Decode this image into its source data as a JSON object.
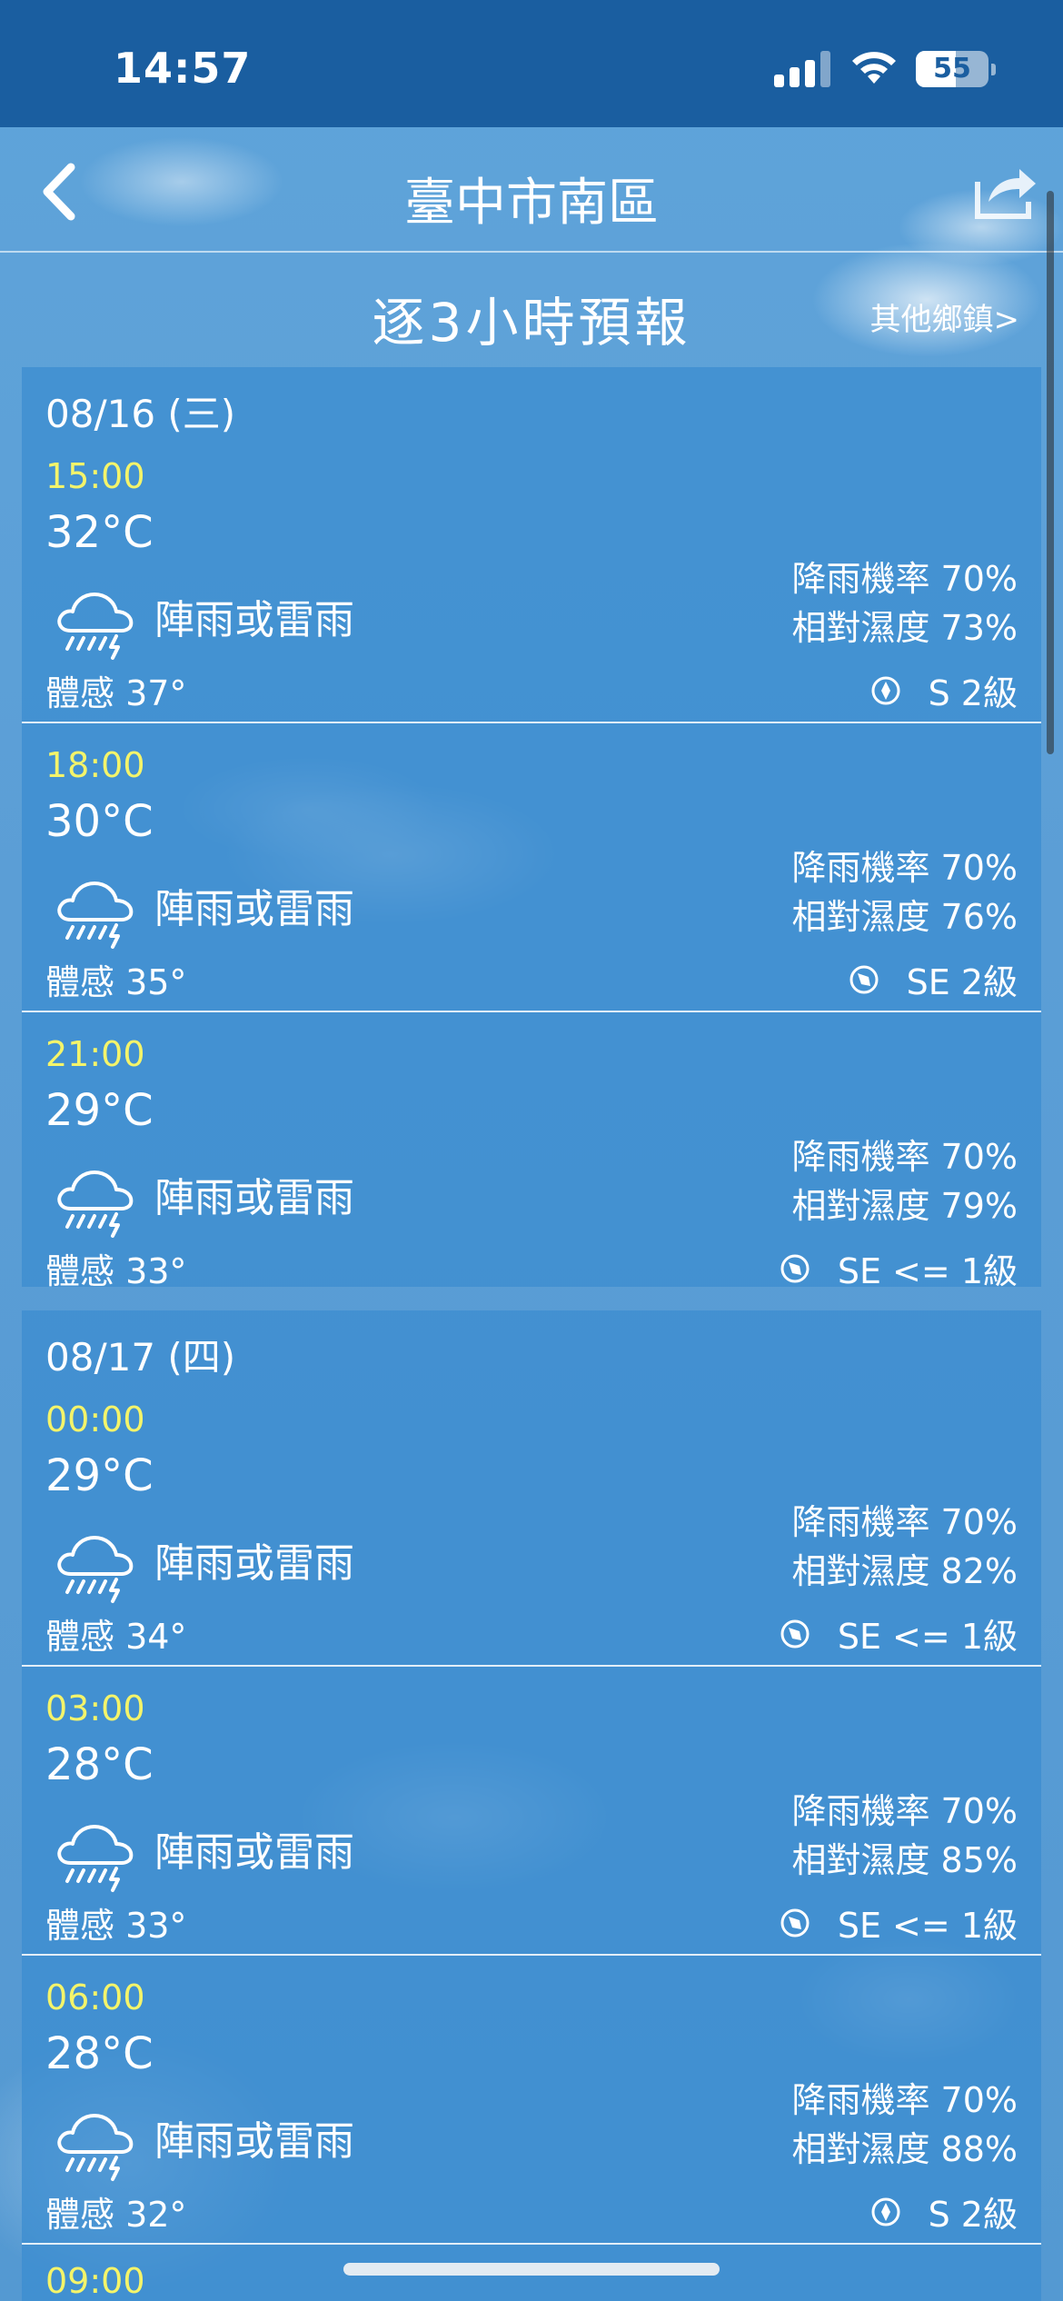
{
  "status_bar": {
    "time": "14:57",
    "battery": "55"
  },
  "nav": {
    "title": "臺中市南區",
    "back_icon": "chevron-left-icon",
    "share_icon": "share-icon"
  },
  "subheader": {
    "title": "逐3小時預報",
    "other_link": "其他鄉鎮>"
  },
  "days": [
    {
      "date": "08/16 (三)",
      "slots": [
        {
          "time": "15:00",
          "temp": "32°C",
          "desc": "陣雨或雷雨",
          "feel": "體感 37°",
          "rain": "降雨機率 70%",
          "humidity": "相對濕度 73%",
          "wind": "S 2級",
          "wind_dir": "S"
        },
        {
          "time": "18:00",
          "temp": "30°C",
          "desc": "陣雨或雷雨",
          "feel": "體感 35°",
          "rain": "降雨機率 70%",
          "humidity": "相對濕度 76%",
          "wind": "SE 2級",
          "wind_dir": "SE"
        },
        {
          "time": "21:00",
          "temp": "29°C",
          "desc": "陣雨或雷雨",
          "feel": "體感 33°",
          "rain": "降雨機率 70%",
          "humidity": "相對濕度 79%",
          "wind": "SE <= 1級",
          "wind_dir": "SE"
        }
      ]
    },
    {
      "date": "08/17 (四)",
      "slots": [
        {
          "time": "00:00",
          "temp": "29°C",
          "desc": "陣雨或雷雨",
          "feel": "體感 34°",
          "rain": "降雨機率 70%",
          "humidity": "相對濕度 82%",
          "wind": "SE <= 1級",
          "wind_dir": "SE"
        },
        {
          "time": "03:00",
          "temp": "28°C",
          "desc": "陣雨或雷雨",
          "feel": "體感 33°",
          "rain": "降雨機率 70%",
          "humidity": "相對濕度 85%",
          "wind": "SE <= 1級",
          "wind_dir": "SE"
        },
        {
          "time": "06:00",
          "temp": "28°C",
          "desc": "陣雨或雷雨",
          "feel": "體感 32°",
          "rain": "降雨機率 70%",
          "humidity": "相對濕度 88%",
          "wind": "S 2級",
          "wind_dir": "S"
        },
        {
          "time": "09:00"
        }
      ]
    }
  ],
  "colors": {
    "status_bar": "#1a5ea0",
    "time_label": "#f4f46a",
    "card": "#3a8cd0"
  }
}
